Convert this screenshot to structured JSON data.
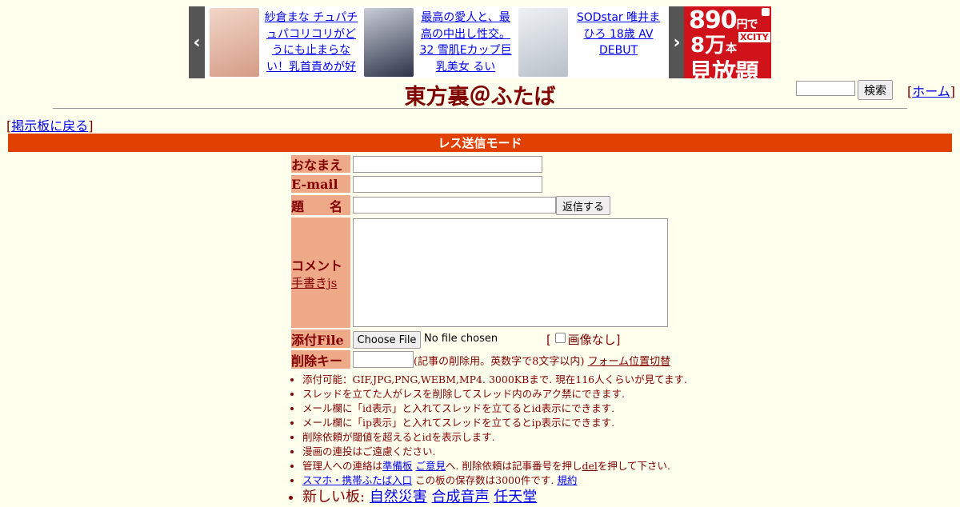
{
  "ads": {
    "items": [
      {
        "text": "紗倉まな チュパチュパコリコリがどうにも止まらない！乳首責めが好",
        "thumb_color": "#e8c3ae"
      },
      {
        "text": "最高の愛人と、最高の中出し性交。 32 雪肌Eカップ巨乳美女 るい",
        "thumb_color": "#3a3f55"
      },
      {
        "text": "SODstar 唯井まひろ 18歳 AV DEBUT",
        "thumb_color": "#d8dde4"
      }
    ],
    "banner": {
      "line1": "890",
      "line1_suffix": "円で",
      "line2": "8万",
      "line2_suffix": "本",
      "brand": "XCITY",
      "line3": "見放題"
    }
  },
  "header": {
    "title": "東方裏＠ふたば",
    "search_button": "検索",
    "home_link": "ホーム"
  },
  "nav": {
    "back_link": "掲示板に戻る"
  },
  "mode_bar": "レス送信モード",
  "form": {
    "name_label": "おなまえ",
    "email_label": "E-mail",
    "subject_label": "題　　名",
    "submit_button": "返信する",
    "comment_label": "コメント",
    "handwriting_link": "手書きjs",
    "file_label": "添付File",
    "choose_file_button": "Choose File",
    "no_file_text": "No file chosen",
    "no_image_label": "画像なし",
    "delkey_label": "削除キー",
    "delkey_note": "(記事の削除用。英数字で8文字以内)",
    "form_position_link": "フォーム位置切替"
  },
  "notes": {
    "line1": "添付可能：GIF,JPG,PNG,WEBM,MP4. 3000KBまで. 現在116人くらいが見てます.",
    "line2": "スレッドを立てた人がレスを削除してスレッド内のみアク禁にできます.",
    "line3": "メール欄に「id表示」と入れてスレッドを立てるとid表示にできます.",
    "line4": "メール欄に「ip表示」と入れてスレッドを立てるとip表示にできます.",
    "line5": "削除依頼が閾値を超えるとidを表示します.",
    "line6": "漫画の連投はご遠慮ください.",
    "line7_pre": "管理人への連絡は",
    "line7_link1": "準備板",
    "line7_link2": "ご意見",
    "line7_mid": "へ. 削除依頼は記事番号を押し",
    "line7_link3": "del",
    "line7_post": "を押して下さい.",
    "line8_link": "スマホ・携帯ふたば入口",
    "line8_mid": " この板の保存数は3000件です.",
    "line8_link2": "規約",
    "line9_pre": "新しい板:",
    "line9_links": [
      "自然災害",
      "合成音声",
      "任天堂"
    ]
  }
}
